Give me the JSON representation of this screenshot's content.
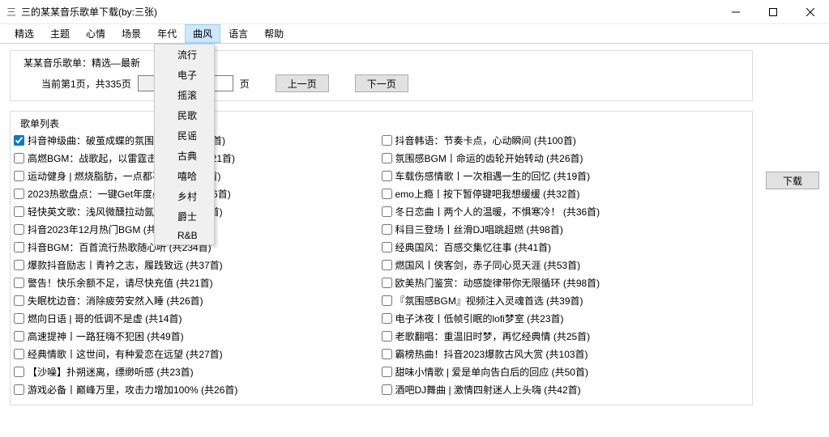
{
  "window": {
    "title": "三的某某音乐歌单下载(by:三张)"
  },
  "menu": {
    "items": [
      "精选",
      "主题",
      "心情",
      "场景",
      "年代",
      "曲风",
      "语言",
      "帮助"
    ],
    "active_index": 5,
    "dropdown": [
      "流行",
      "电子",
      "摇滚",
      "民歌",
      "民谣",
      "古典",
      "嘻哈",
      "乡村",
      "爵士",
      "R&B"
    ]
  },
  "group": {
    "title": "某某音乐歌单：精选—最新",
    "page_info": "当前第1页，共335页",
    "page_input_value": "",
    "page_label": "页",
    "prev": "上一页",
    "next": "下一页"
  },
  "list": {
    "title": "歌单列表",
    "left": [
      {
        "checked": true,
        "label": "抖音神级曲：破茧成蝶的氛围感BGM  (共22首)"
      },
      {
        "checked": false,
        "label": "高燃BGM：战歌起，以雷霆击碎黑暗！  (共21首)"
      },
      {
        "checked": false,
        "label": "运动健身 | 燃烧脂肪，一点都不能剩  (共23首)"
      },
      {
        "checked": false,
        "label": "2023热歌盘点：一键Get年度必听精选  (共56首)"
      },
      {
        "checked": false,
        "label": "轻快英文歌：浅风微醺拉动氤氲柔肠  (共28首)"
      },
      {
        "checked": false,
        "label": "抖音2023年12月热门BGM  (共33首)"
      },
      {
        "checked": false,
        "label": "抖音BGM：百首流行热歌随心听  (共234首)"
      },
      {
        "checked": false,
        "label": "爆款抖音励志丨青衿之志，履践致远  (共37首)"
      },
      {
        "checked": false,
        "label": "警告！快乐余额不足，请尽快充值  (共21首)"
      },
      {
        "checked": false,
        "label": "失眠枕边音：消除疲劳安然入睡  (共26首)"
      },
      {
        "checked": false,
        "label": "燃向日语 | 哥的低调不是虚  (共14首)"
      },
      {
        "checked": false,
        "label": "高速提神丨一路狂嗨不犯困  (共49首)"
      },
      {
        "checked": false,
        "label": "经典情歌丨这世间，有种爱恋在远望  (共27首)"
      },
      {
        "checked": false,
        "label": "【沙噪】扑朔迷离，缥缈听感  (共23首)"
      },
      {
        "checked": false,
        "label": "游戏必备丨巅峰万里，攻击力增加100%  (共26首)"
      }
    ],
    "right": [
      {
        "checked": false,
        "label": "抖音韩语：节奏卡点，心动瞬间  (共100首)"
      },
      {
        "checked": false,
        "label": "氛围感BGM丨命运的齿轮开始转动  (共26首)"
      },
      {
        "checked": false,
        "label": "车载伤感情歌丨一次相遇一生的回忆  (共19首)"
      },
      {
        "checked": false,
        "label": "emo上瘾丨按下暂停键吧我想缓缓  (共32首)"
      },
      {
        "checked": false,
        "label": "冬日恋曲丨两个人的温暖，不惧寒冷！  (共36首)"
      },
      {
        "checked": false,
        "label": "科目三登场丨丝滑DJ唱跳超燃  (共98首)"
      },
      {
        "checked": false,
        "label": "经典国风：百感交集忆往事  (共41首)"
      },
      {
        "checked": false,
        "label": "燃国风丨侠客剑，赤子同心觅天涯  (共53首)"
      },
      {
        "checked": false,
        "label": "欧美热门鉴赏：动感旋律带你无限循环  (共98首)"
      },
      {
        "checked": false,
        "label": "『氛围感BGM』视频注入灵魂首选  (共39首)"
      },
      {
        "checked": false,
        "label": "电子沐夜丨低帧引眠的lofi梦室  (共23首)"
      },
      {
        "checked": false,
        "label": "老歌翻唱：重温旧时梦，再忆经典情  (共25首)"
      },
      {
        "checked": false,
        "label": "霸榜热曲！抖音2023爆款古风大赏  (共103首)"
      },
      {
        "checked": false,
        "label": "甜味小情歌 | 爱是单向告白后的回应  (共50首)"
      },
      {
        "checked": false,
        "label": "酒吧DJ舞曲 | 激情四射迷人上头嗨  (共42首)"
      }
    ]
  },
  "download": "下载"
}
